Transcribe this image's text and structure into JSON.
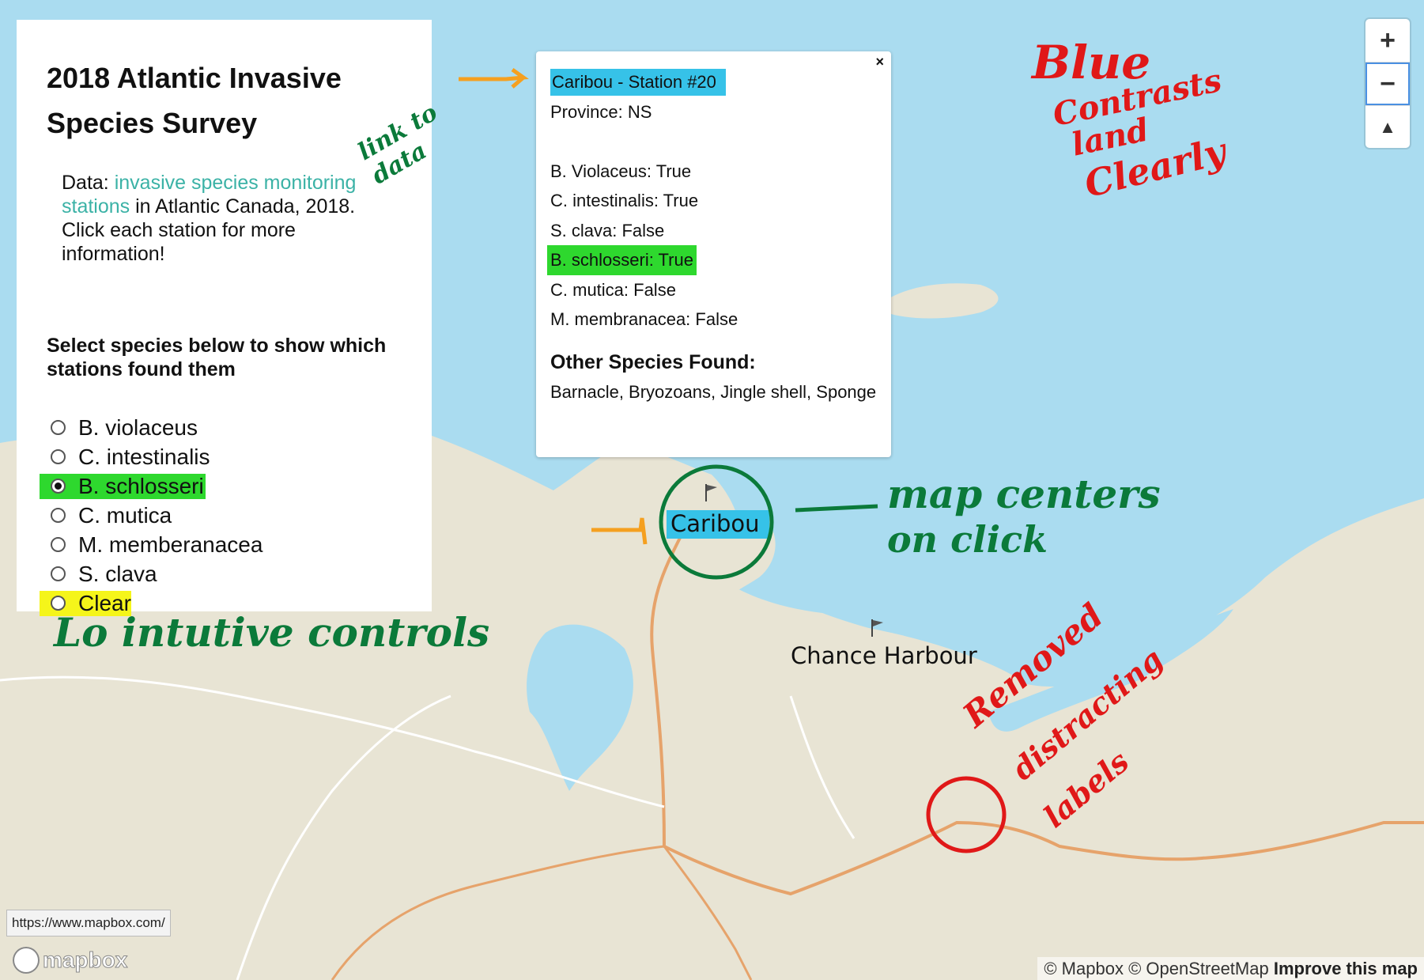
{
  "panel": {
    "title_line1": "2018 Atlantic Invasive",
    "title_line2": "Species Survey",
    "data_prefix": "Data: ",
    "data_link": "invasive species monitoring stations",
    "data_suffix": " in Atlantic Canada, 2018. Click each station for more information!",
    "filter_heading": "Select species below to show which stations found them",
    "options": [
      {
        "label": "B. violaceus",
        "checked": false
      },
      {
        "label": "C. intestinalis",
        "checked": false
      },
      {
        "label": "B. schlosseri",
        "checked": true
      },
      {
        "label": "C. mutica",
        "checked": false
      },
      {
        "label": "M. memberanacea",
        "checked": false
      },
      {
        "label": "S. clava",
        "checked": false
      },
      {
        "label": "Clear",
        "checked": false
      }
    ]
  },
  "popup": {
    "close": "×",
    "title": "Caribou - Station #20",
    "province": "Province: NS",
    "species": [
      "B. Violaceus: True",
      "C. intestinalis: True",
      "S. clava: False",
      "B. schlosseri: True",
      "C. mutica: False",
      "M. membranacea: False"
    ],
    "other_heading": "Other Species Found:",
    "other_text": "Barnacle, Bryozoans, Jingle shell, Sponge"
  },
  "map": {
    "places": [
      "Caribou",
      "Chance Harbour"
    ],
    "water_color": "#aadcf0",
    "land_color": "#e8e4d4"
  },
  "controls": {
    "zoom_in": "+",
    "zoom_out": "−",
    "compass": "▲"
  },
  "attribution": {
    "mapbox": "© Mapbox",
    "osm": "© OpenStreetMap",
    "improve": "Improve this map"
  },
  "url": "https://www.mapbox.com/",
  "logo": "mapbox",
  "annotations": {
    "link": "link to data",
    "blue_1": "Blue",
    "blue_2": "Contrasts",
    "blue_3": "land",
    "blue_4": "Clearly",
    "centers_1": "map centers",
    "centers_2": "on click",
    "controls": "Lo intutive controls",
    "removed_1": "Removed",
    "removed_2": "distracting",
    "removed_3": "labels"
  }
}
